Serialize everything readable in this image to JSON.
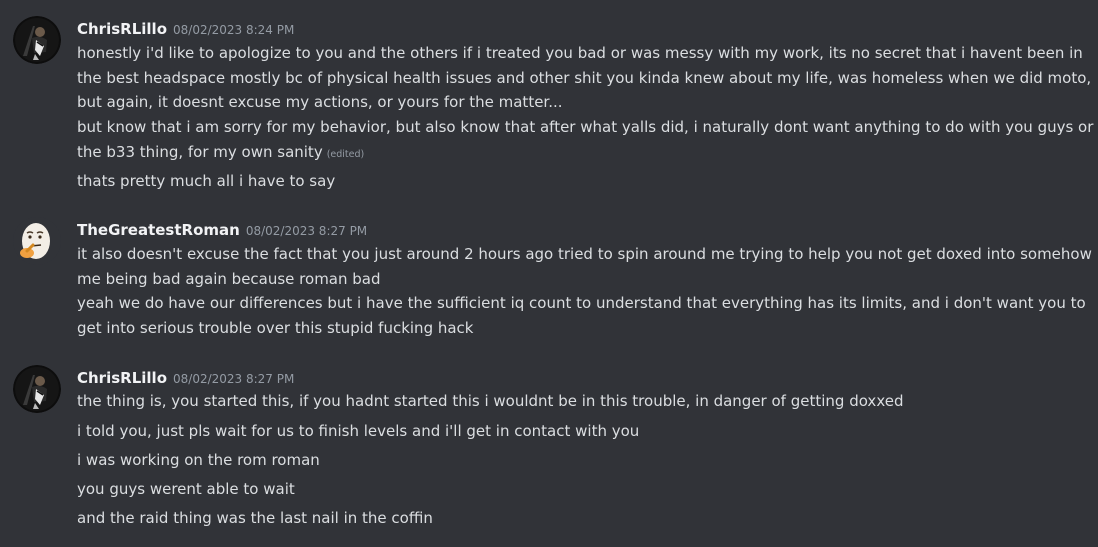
{
  "messages": [
    {
      "author": "ChrisRLillo",
      "timestamp": "08/02/2023 8:24 PM",
      "avatar_icon": "guitarist-avatar-icon",
      "lines": [
        "honestly i'd like to apologize to you and the others if i treated you bad or was messy with my work, its no secret that i havent been in the best headspace mostly bc of physical health issues and other shit you kinda knew about my life, was homeless when we did moto, but again, it doesnt excuse my actions, or yours for the matter...",
        "but know that i am sorry for my behavior, but also know that after what yalls did, i naturally dont want anything to do with you guys or the b33 thing, for my own sanity",
        "thats pretty much all i have to say"
      ],
      "edited_label": "(edited)"
    },
    {
      "author": "TheGreatestRoman",
      "timestamp": "08/02/2023 8:27 PM",
      "avatar_icon": "thinking-egg-avatar-icon",
      "lines": [
        "it also doesn't excuse the fact that you just around 2 hours ago tried to spin around me trying to help you not get doxed into somehow me being bad again because roman bad",
        "yeah we do have our differences but i have the sufficient iq count to understand that everything has its limits, and i don't want you to get into serious trouble over this stupid fucking hack"
      ]
    },
    {
      "author": "ChrisRLillo",
      "timestamp": "08/02/2023 8:27 PM",
      "avatar_icon": "guitarist-avatar-icon",
      "lines": [
        "the thing is, you started this, if you hadnt started this i wouldnt be in this trouble, in danger of getting doxxed",
        "i told you, just pls wait for us to finish levels and i'll get in contact with you",
        "i was working on the rom roman",
        "you guys werent able to wait",
        "and the raid thing was the last nail in the coffin"
      ]
    }
  ],
  "colors": {
    "background": "#313338",
    "username": "#f2f3f5",
    "text": "#dbdee1",
    "muted": "#949ba4"
  }
}
